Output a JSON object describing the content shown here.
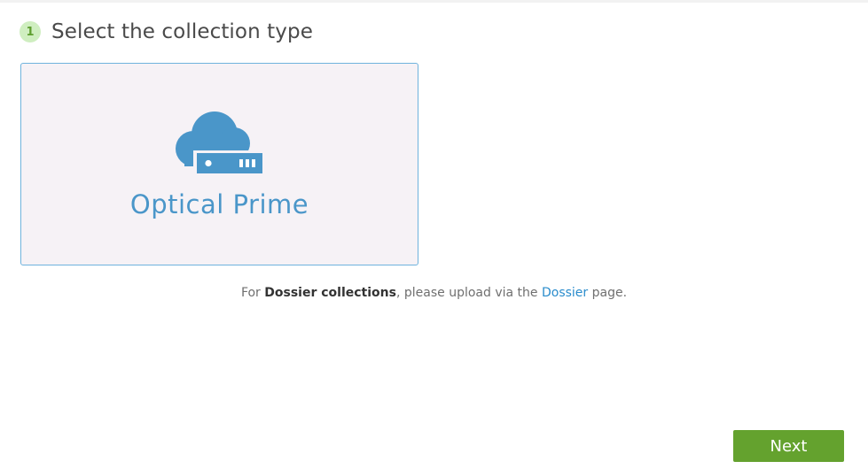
{
  "step": {
    "number": "1",
    "title": "Select the collection type"
  },
  "card": {
    "icon": "cloud-server-icon",
    "label": "Optical Prime",
    "accent_color": "#4a96c9"
  },
  "info": {
    "prefix": "For ",
    "bold_text": "Dossier collections",
    "middle": ", please upload via the ",
    "link_text": "Dossier",
    "suffix": " page."
  },
  "actions": {
    "next_label": "Next",
    "next_color": "#64a22e"
  }
}
